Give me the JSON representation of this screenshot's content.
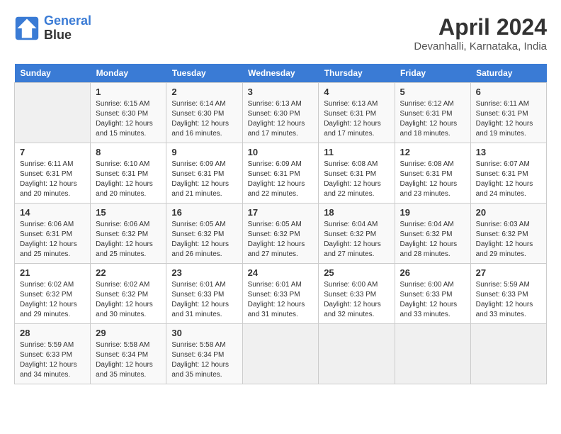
{
  "header": {
    "logo_line1": "General",
    "logo_line2": "Blue",
    "title": "April 2024",
    "subtitle": "Devanhalli, Karnataka, India"
  },
  "calendar": {
    "days_of_week": [
      "Sunday",
      "Monday",
      "Tuesday",
      "Wednesday",
      "Thursday",
      "Friday",
      "Saturday"
    ],
    "weeks": [
      [
        {
          "day": "",
          "info": ""
        },
        {
          "day": "1",
          "info": "Sunrise: 6:15 AM\nSunset: 6:30 PM\nDaylight: 12 hours\nand 15 minutes."
        },
        {
          "day": "2",
          "info": "Sunrise: 6:14 AM\nSunset: 6:30 PM\nDaylight: 12 hours\nand 16 minutes."
        },
        {
          "day": "3",
          "info": "Sunrise: 6:13 AM\nSunset: 6:30 PM\nDaylight: 12 hours\nand 17 minutes."
        },
        {
          "day": "4",
          "info": "Sunrise: 6:13 AM\nSunset: 6:31 PM\nDaylight: 12 hours\nand 17 minutes."
        },
        {
          "day": "5",
          "info": "Sunrise: 6:12 AM\nSunset: 6:31 PM\nDaylight: 12 hours\nand 18 minutes."
        },
        {
          "day": "6",
          "info": "Sunrise: 6:11 AM\nSunset: 6:31 PM\nDaylight: 12 hours\nand 19 minutes."
        }
      ],
      [
        {
          "day": "7",
          "info": "Sunrise: 6:11 AM\nSunset: 6:31 PM\nDaylight: 12 hours\nand 20 minutes."
        },
        {
          "day": "8",
          "info": "Sunrise: 6:10 AM\nSunset: 6:31 PM\nDaylight: 12 hours\nand 20 minutes."
        },
        {
          "day": "9",
          "info": "Sunrise: 6:09 AM\nSunset: 6:31 PM\nDaylight: 12 hours\nand 21 minutes."
        },
        {
          "day": "10",
          "info": "Sunrise: 6:09 AM\nSunset: 6:31 PM\nDaylight: 12 hours\nand 22 minutes."
        },
        {
          "day": "11",
          "info": "Sunrise: 6:08 AM\nSunset: 6:31 PM\nDaylight: 12 hours\nand 22 minutes."
        },
        {
          "day": "12",
          "info": "Sunrise: 6:08 AM\nSunset: 6:31 PM\nDaylight: 12 hours\nand 23 minutes."
        },
        {
          "day": "13",
          "info": "Sunrise: 6:07 AM\nSunset: 6:31 PM\nDaylight: 12 hours\nand 24 minutes."
        }
      ],
      [
        {
          "day": "14",
          "info": "Sunrise: 6:06 AM\nSunset: 6:31 PM\nDaylight: 12 hours\nand 25 minutes."
        },
        {
          "day": "15",
          "info": "Sunrise: 6:06 AM\nSunset: 6:32 PM\nDaylight: 12 hours\nand 25 minutes."
        },
        {
          "day": "16",
          "info": "Sunrise: 6:05 AM\nSunset: 6:32 PM\nDaylight: 12 hours\nand 26 minutes."
        },
        {
          "day": "17",
          "info": "Sunrise: 6:05 AM\nSunset: 6:32 PM\nDaylight: 12 hours\nand 27 minutes."
        },
        {
          "day": "18",
          "info": "Sunrise: 6:04 AM\nSunset: 6:32 PM\nDaylight: 12 hours\nand 27 minutes."
        },
        {
          "day": "19",
          "info": "Sunrise: 6:04 AM\nSunset: 6:32 PM\nDaylight: 12 hours\nand 28 minutes."
        },
        {
          "day": "20",
          "info": "Sunrise: 6:03 AM\nSunset: 6:32 PM\nDaylight: 12 hours\nand 29 minutes."
        }
      ],
      [
        {
          "day": "21",
          "info": "Sunrise: 6:02 AM\nSunset: 6:32 PM\nDaylight: 12 hours\nand 29 minutes."
        },
        {
          "day": "22",
          "info": "Sunrise: 6:02 AM\nSunset: 6:32 PM\nDaylight: 12 hours\nand 30 minutes."
        },
        {
          "day": "23",
          "info": "Sunrise: 6:01 AM\nSunset: 6:33 PM\nDaylight: 12 hours\nand 31 minutes."
        },
        {
          "day": "24",
          "info": "Sunrise: 6:01 AM\nSunset: 6:33 PM\nDaylight: 12 hours\nand 31 minutes."
        },
        {
          "day": "25",
          "info": "Sunrise: 6:00 AM\nSunset: 6:33 PM\nDaylight: 12 hours\nand 32 minutes."
        },
        {
          "day": "26",
          "info": "Sunrise: 6:00 AM\nSunset: 6:33 PM\nDaylight: 12 hours\nand 33 minutes."
        },
        {
          "day": "27",
          "info": "Sunrise: 5:59 AM\nSunset: 6:33 PM\nDaylight: 12 hours\nand 33 minutes."
        }
      ],
      [
        {
          "day": "28",
          "info": "Sunrise: 5:59 AM\nSunset: 6:33 PM\nDaylight: 12 hours\nand 34 minutes."
        },
        {
          "day": "29",
          "info": "Sunrise: 5:58 AM\nSunset: 6:34 PM\nDaylight: 12 hours\nand 35 minutes."
        },
        {
          "day": "30",
          "info": "Sunrise: 5:58 AM\nSunset: 6:34 PM\nDaylight: 12 hours\nand 35 minutes."
        },
        {
          "day": "",
          "info": ""
        },
        {
          "day": "",
          "info": ""
        },
        {
          "day": "",
          "info": ""
        },
        {
          "day": "",
          "info": ""
        }
      ]
    ]
  }
}
